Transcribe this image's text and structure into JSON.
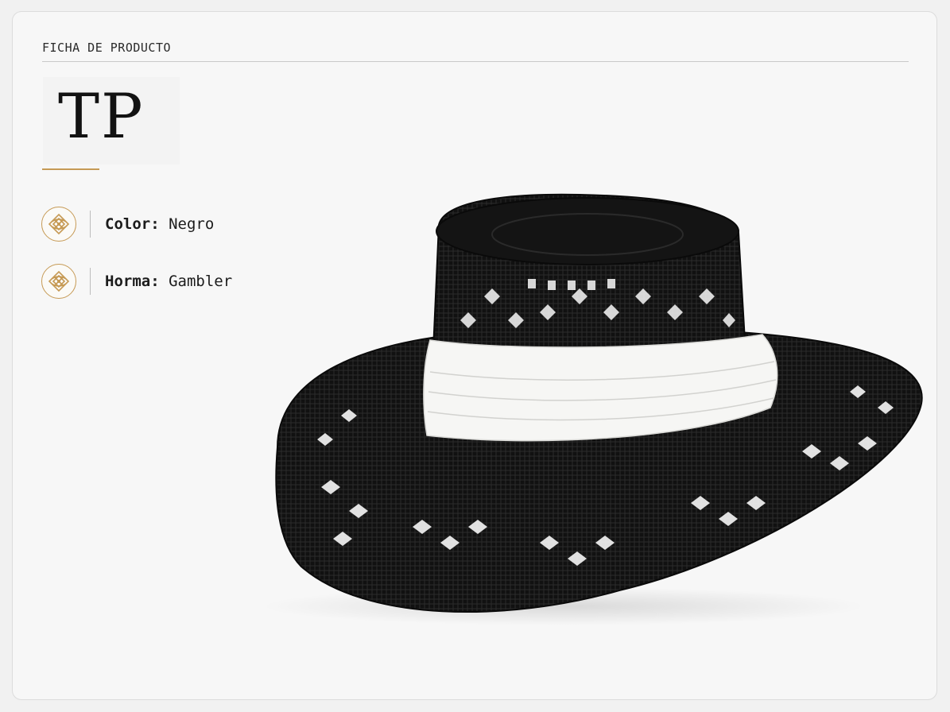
{
  "header": {
    "eyebrow": "FICHA DE PRODUCTO"
  },
  "brand": {
    "logo_text": "TP"
  },
  "attributes": [
    {
      "key": "Color:",
      "value": "Negro",
      "icon": "woven-knot-icon"
    },
    {
      "key": "Horma:",
      "value": "Gambler",
      "icon": "woven-knot-icon"
    }
  ],
  "colors": {
    "accent": "#c69a55",
    "hat": "#111111",
    "band": "#f6f6f4"
  },
  "image": {
    "subject": "product-photo"
  }
}
